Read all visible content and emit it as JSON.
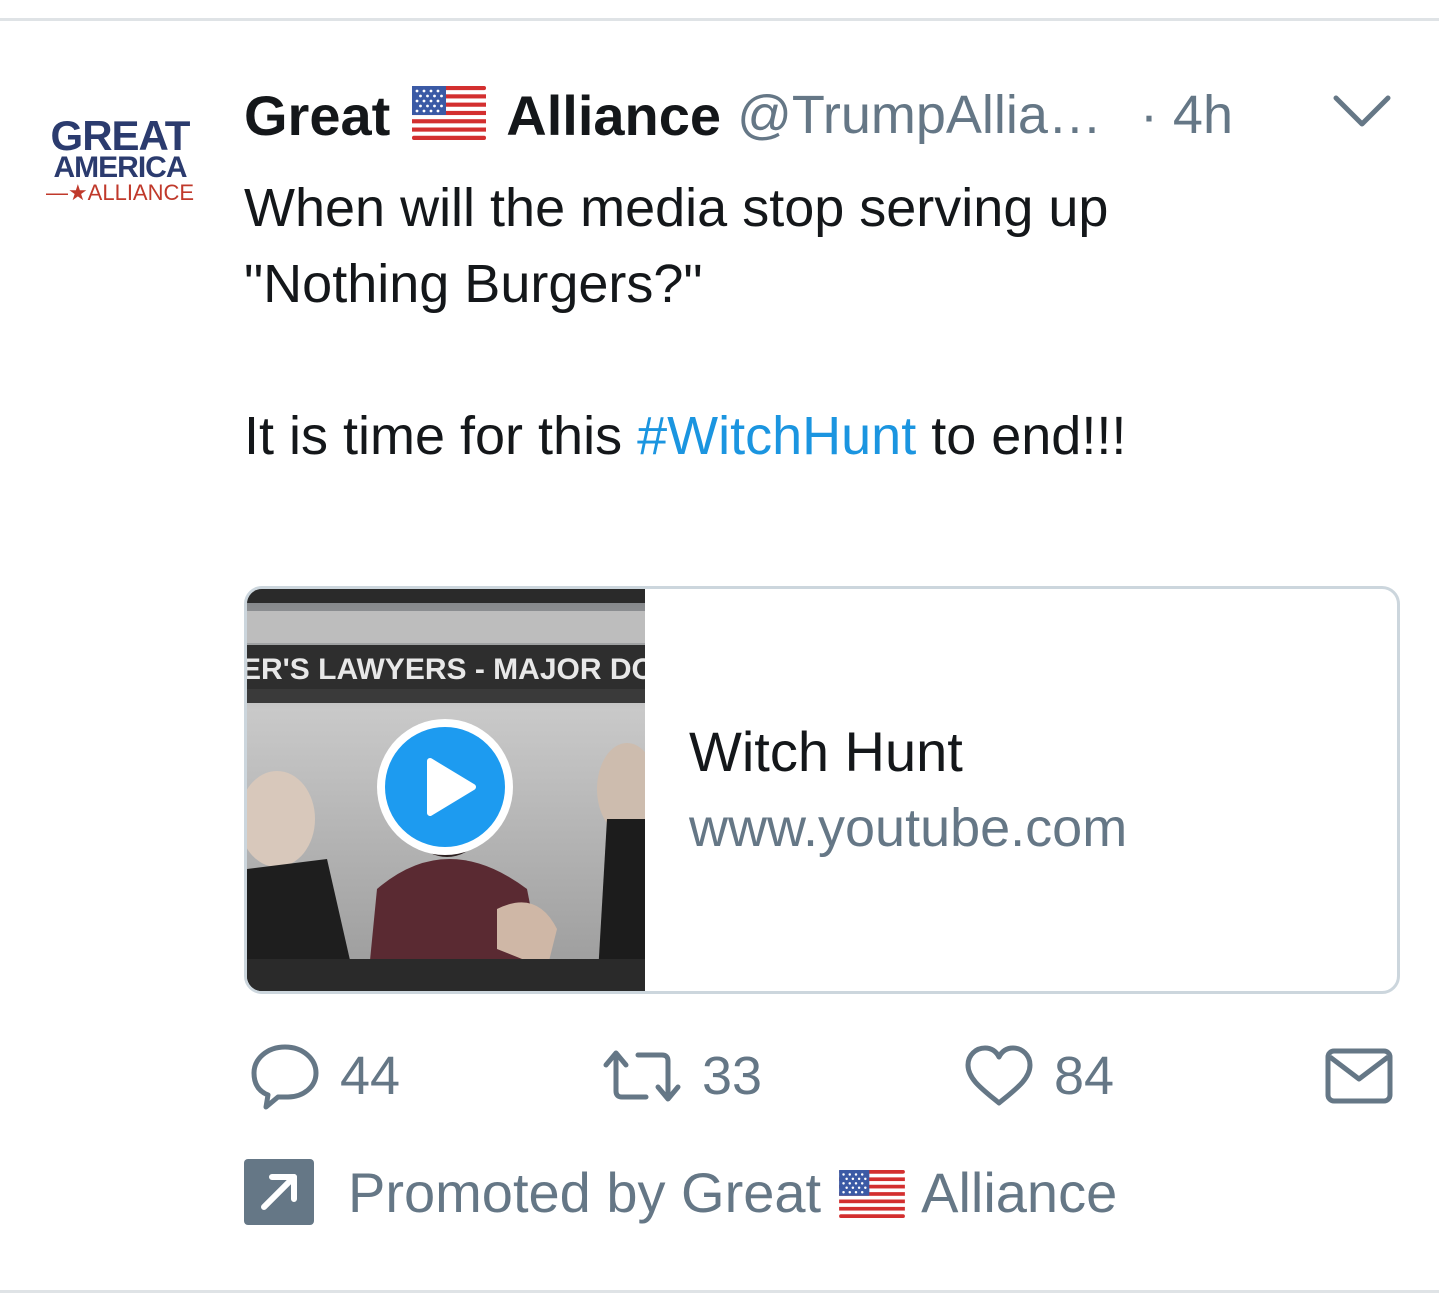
{
  "avatar": {
    "line1": "GREAT",
    "line2": "AMERICA",
    "line3": "ALLIANCE"
  },
  "header": {
    "name_before_flag": "Great",
    "flag_icon": "us-flag-icon",
    "name_after_flag": "Alliance",
    "handle": "@TrumpAllia…",
    "time": "· 4h",
    "menu_icon": "chevron-down-icon"
  },
  "tweet": {
    "line1": "When will the media stop serving up",
    "line2": "\"Nothing Burgers?\"",
    "line3_before": "It is time for this ",
    "hashtag": "#WitchHunt",
    "line3_after": " to end!!!"
  },
  "card": {
    "thumbnail_caption": "ER'S LAWYERS - MAJOR DONA",
    "title": "Witch Hunt",
    "url": "www.youtube.com",
    "play_icon": "play-icon"
  },
  "actions": {
    "reply_count": "44",
    "retweet_count": "33",
    "like_count": "84"
  },
  "promoted": {
    "text_before_flag": "Promoted by Great",
    "text_after_flag": "Alliance"
  },
  "colors": {
    "text": "#14171a",
    "secondary": "#657786",
    "link": "#1b95e0",
    "border": "#ccd6dd"
  }
}
